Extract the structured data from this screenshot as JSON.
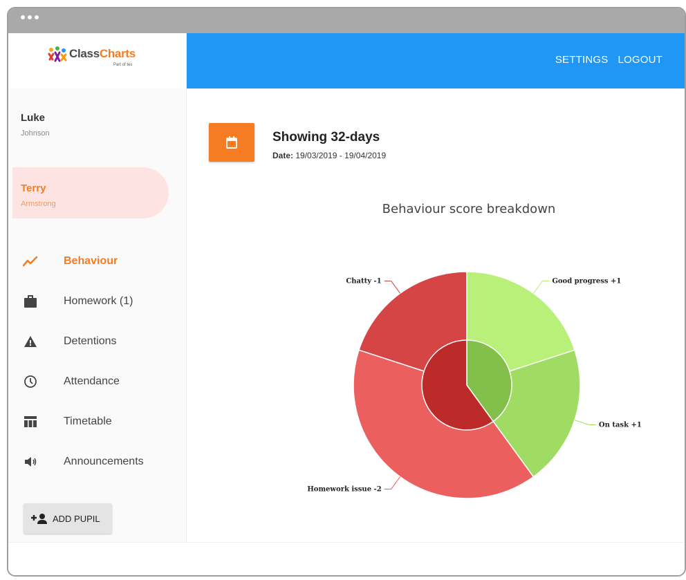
{
  "app": {
    "logo_part1": "Class",
    "logo_part2": "Charts",
    "logo_tagline": "Part of tes"
  },
  "header": {
    "settings_label": "SETTINGS",
    "logout_label": "LOGOUT",
    "bar_color": "#2196f3"
  },
  "pupils": [
    {
      "first": "Luke",
      "last": "Johnson",
      "active": false
    },
    {
      "first": "Terry",
      "last": "Armstrong",
      "active": true
    }
  ],
  "nav": {
    "items": [
      {
        "label": "Behaviour",
        "icon": "trend-line-icon",
        "active": true
      },
      {
        "label": "Homework (1)",
        "icon": "briefcase-icon",
        "active": false
      },
      {
        "label": "Detentions",
        "icon": "warning-triangle-icon",
        "active": false
      },
      {
        "label": "Attendance",
        "icon": "clock-icon",
        "active": false
      },
      {
        "label": "Timetable",
        "icon": "timetable-icon",
        "active": false
      },
      {
        "label": "Announcements",
        "icon": "speaker-icon",
        "active": false
      }
    ],
    "add_pupil_label": "ADD PUPIL"
  },
  "period": {
    "showing": "Showing 32-days",
    "date_label": "Date:",
    "date_range": "19/03/2019 - 19/04/2019",
    "icon": "calendar-icon"
  },
  "colors": {
    "accent": "#f57c22",
    "positive_outer": "#b8f07a",
    "positive_outer_2": "#a0dc63",
    "positive_inner": "#82bf4b",
    "negative_outer": "#d54545",
    "negative_outer_2": "#ec5f5f",
    "negative_inner": "#bc2a2a"
  },
  "chart_data": {
    "type": "pie",
    "title": "Behaviour score breakdown",
    "outer_ring": [
      {
        "label": "Good progress +1",
        "value": 1,
        "kind": "positive"
      },
      {
        "label": "On task +1",
        "value": 1,
        "kind": "positive"
      },
      {
        "label": "Homework issue -2",
        "value": 2,
        "kind": "negative"
      },
      {
        "label": "Chatty -1",
        "value": 1,
        "kind": "negative"
      }
    ],
    "inner_ring": [
      {
        "kind": "positive",
        "value": 2
      },
      {
        "kind": "negative",
        "value": 3
      }
    ]
  }
}
